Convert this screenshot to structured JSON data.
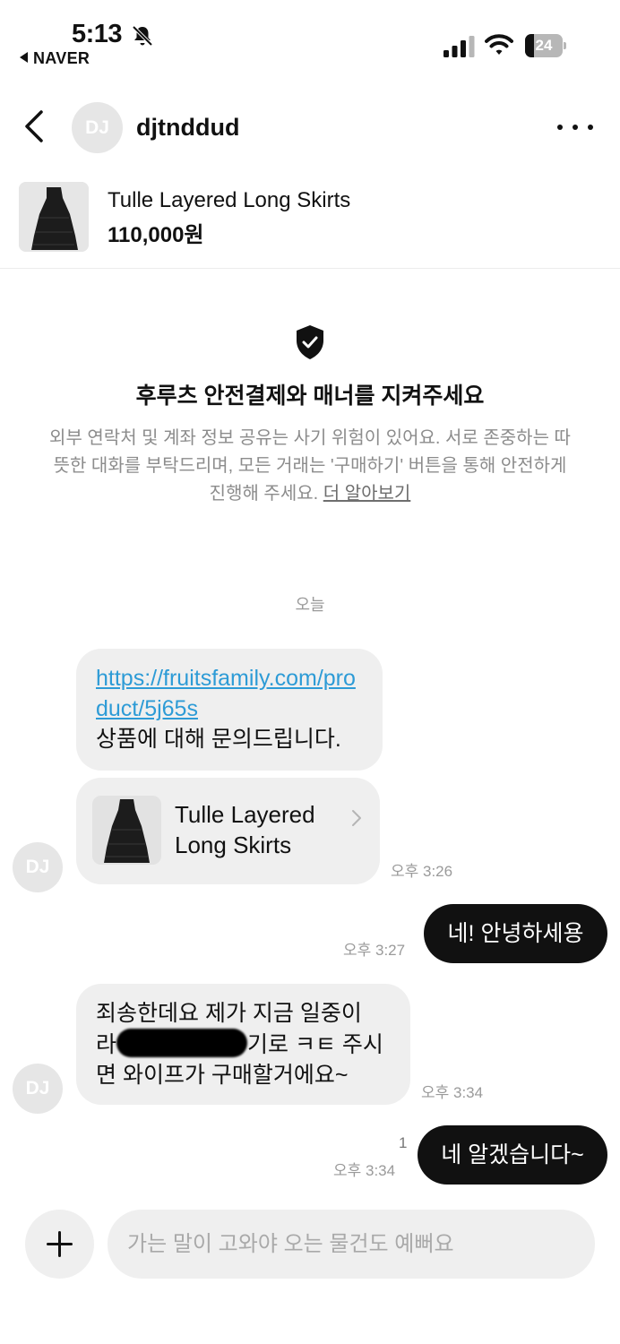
{
  "status_bar": {
    "time": "5:13",
    "back_app": "NAVER",
    "battery": "24",
    "battery_level_pct": 24,
    "icons": [
      "bell-muted-icon",
      "signal-icon",
      "wifi-icon",
      "battery-icon"
    ]
  },
  "header": {
    "avatar_initials": "DJ",
    "username": "djtnddud",
    "icons": [
      "chevron-left-icon",
      "more-icon"
    ]
  },
  "product": {
    "name": "Tulle Layered Long Skirts",
    "price": "110,000원"
  },
  "notice": {
    "title": "후루츠 안전결제와 매너를 지켜주세요",
    "body": "외부 연락처 및 계좌 정보 공유는 사기 위험이 있어요. 서로 존중하는 따뜻한 대화를 부탁드리며, 모든 거래는 '구매하기' 버튼을 통해 안전하게 진행해 주세요.",
    "link": "더 알아보기"
  },
  "date_separator": "오늘",
  "messages": {
    "m1": {
      "link": "https://fruitsfamily.com/product/5j65s",
      "text": "상품에 대해 문의드립니다.",
      "card_title": "Tulle Layered Long Skirts",
      "time": "오후 3:26",
      "avatar": "DJ"
    },
    "m2": {
      "text": "네! 안녕하세용",
      "time": "오후 3:27"
    },
    "m3": {
      "line1": "죄송한데요 제가 지금 일중이",
      "line2_pre": "라",
      "line2_post": "기로 ㅋㅌ 주시",
      "line3": "면 와이프가 구매할거에요~",
      "time": "오후 3:34",
      "avatar": "DJ"
    },
    "m4": {
      "text": "네 알겠습니다~",
      "time": "오후 3:34",
      "unread_count": "1"
    }
  },
  "composer": {
    "placeholder": "가는 말이 고와야 오는 물건도 예뻐요"
  },
  "colors": {
    "link": "#2d9bd6",
    "incoming_bubble": "#efefef",
    "outgoing_bubble": "#111111",
    "muted_text": "#9a9a9a"
  }
}
